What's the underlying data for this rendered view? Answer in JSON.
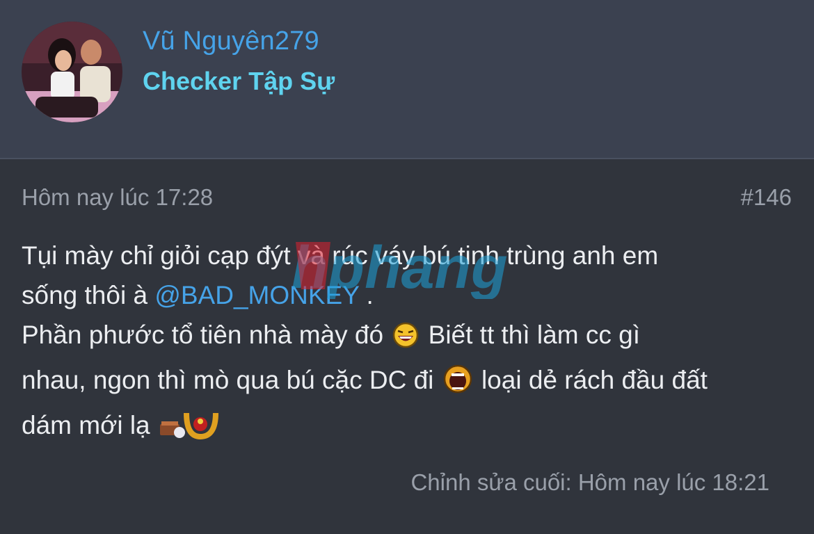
{
  "user": {
    "name": "Vũ Nguyên279",
    "title": "Checker Tập Sự"
  },
  "post": {
    "date": "Hôm nay lúc 17:28",
    "number": "#146",
    "line1": "Tụi mày chỉ giỏi cạp đýt và rúc váy bú tinh trùng anh em",
    "line2_pre": "sống thôi à ",
    "mention": "@BAD_MONKEY",
    "line2_post": " .",
    "line3": "Phần phước tổ tiên nhà mày đó",
    "line3b": " Biết tt thì làm cc gì",
    "line4": "nhau, ngon thì mò qua bú cặc DC đi",
    "line4b": " loại dẻ rách đầu đất",
    "line5": "dám mới lạ",
    "edited": "Chỉnh sửa cuối: Hôm nay lúc 18:21"
  },
  "watermark": {
    "text": "hphang"
  },
  "icons": {
    "smiley1": "laughing-smiley-icon",
    "smiley2": "shouting-smiley-icon",
    "smiley3": "horseshoe-smiley-icon"
  },
  "colors": {
    "header_bg": "#3b4150",
    "body_bg": "#30343c",
    "username": "#46a3e8",
    "user_title": "#5fd3ef",
    "text": "#eceef1",
    "muted": "#9aa0aa"
  }
}
